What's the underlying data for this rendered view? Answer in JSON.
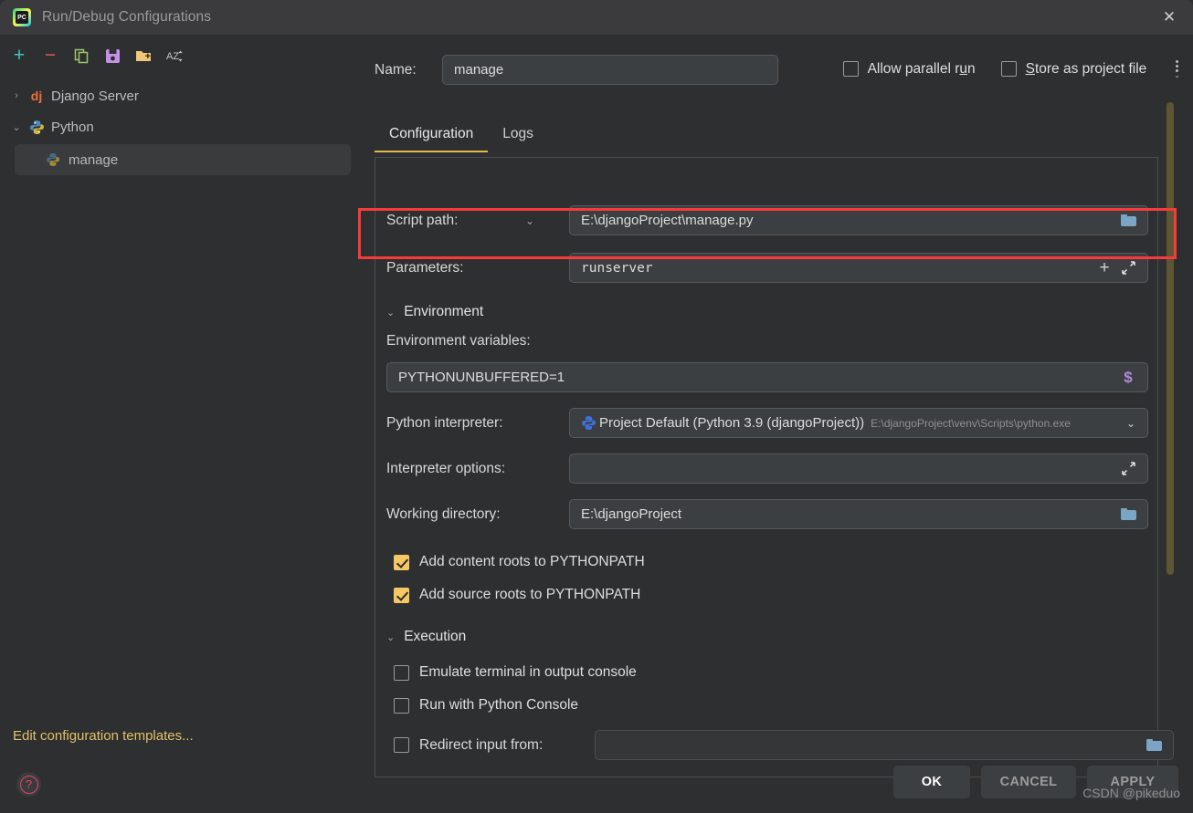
{
  "window": {
    "title": "Run/Debug Configurations",
    "logo_icon": "pycharm-logo-icon",
    "logo_text": "PC",
    "close_icon": "close-icon"
  },
  "sidebar": {
    "toolbar": [
      {
        "name": "add-configuration-button",
        "icon": "plus-icon",
        "glyph": "+"
      },
      {
        "name": "remove-configuration-button",
        "icon": "minus-icon",
        "glyph": "−"
      },
      {
        "name": "copy-configuration-button",
        "icon": "copy-icon",
        "glyph": ""
      },
      {
        "name": "save-configuration-button",
        "icon": "save-floppy-icon",
        "glyph": ""
      },
      {
        "name": "move-into-folder-button",
        "icon": "folder-add-icon",
        "glyph": ""
      },
      {
        "name": "sort-configurations-button",
        "icon": "sort-az-icon",
        "glyph": "AZ"
      }
    ],
    "tree": [
      {
        "label": "Django Server",
        "icon": "django-icon",
        "icon_text": "dj",
        "expanded": false,
        "arrow": "›"
      },
      {
        "label": "Python",
        "icon": "python-icon",
        "expanded": true,
        "arrow": "∨"
      }
    ],
    "selected_child": {
      "label": "manage",
      "icon": "python-icon"
    },
    "edit_templates_link": "Edit configuration templates...",
    "help_icon": "help-circle-icon",
    "help_glyph": "?"
  },
  "header": {
    "name_label": "Name:",
    "name_value": "manage",
    "allow_parallel_run": {
      "label_pre": "Allow parallel r",
      "label_key": "u",
      "label_post": "n",
      "checked": false
    },
    "store_as_project_file": {
      "label_key": "S",
      "label_post": "tore as project file",
      "checked": false
    },
    "options_menu_icon": "more-options-icon"
  },
  "tabs": [
    {
      "label": "Configuration",
      "active": true
    },
    {
      "label": "Logs",
      "active": false
    }
  ],
  "config": {
    "script_path": {
      "label": "Script path:",
      "value": "E:\\djangoProject\\manage.py",
      "dropdown_icon": "chevron-down-icon",
      "browse_icon": "folder-icon"
    },
    "parameters": {
      "label": "Parameters:",
      "value": "runserver",
      "add_icon": "plus-icon",
      "expand_icon": "expand-arrows-icon",
      "highlighted": true
    },
    "environment_section": {
      "label": "Environment",
      "chevron_icon": "chevron-down-icon",
      "env_vars_label": "Environment variables:",
      "env_vars_value": "PYTHONUNBUFFERED=1",
      "env_vars_macro_icon": "dollar-macro-icon",
      "interpreter_label": "Python interpreter:",
      "interpreter_value": "Project Default (Python 3.9 (djangoProject))",
      "interpreter_path": "E:\\djangoProject\\venv\\Scripts\\python.exe",
      "interpreter_icon": "python-icon",
      "interpreter_dropdown_icon": "chevron-down-icon",
      "interpreter_options_label": "Interpreter options:",
      "interpreter_options_value": "",
      "interpreter_options_expand_icon": "expand-arrows-icon",
      "working_directory_label": "Working directory:",
      "working_directory_value": "E:\\djangoProject",
      "working_directory_browse_icon": "folder-icon",
      "checkboxes": [
        {
          "label": "Add content roots to PYTHONPATH",
          "checked": true
        },
        {
          "label": "Add source roots to PYTHONPATH",
          "checked": true
        }
      ]
    },
    "execution_section": {
      "label": "Execution",
      "chevron_icon": "chevron-down-icon",
      "checkboxes": [
        {
          "label": "Emulate terminal in output console",
          "checked": false
        },
        {
          "label": "Run with Python Console",
          "checked": false
        }
      ],
      "redirect_input": {
        "label": "Redirect input from:",
        "checked": false,
        "value": "",
        "browse_icon": "folder-icon",
        "disabled": true
      }
    }
  },
  "footer": {
    "ok_label": "OK",
    "cancel_label": "CANCEL",
    "apply_label": "APPLY",
    "watermark": "CSDN @pikeduo"
  },
  "colors": {
    "accent_yellow": "#e0b84e",
    "highlight_red": "#f93a3a",
    "link_yellow": "#e0c068",
    "checkbox_checked": "#f3c865",
    "scrollbar": "#5e5534"
  }
}
